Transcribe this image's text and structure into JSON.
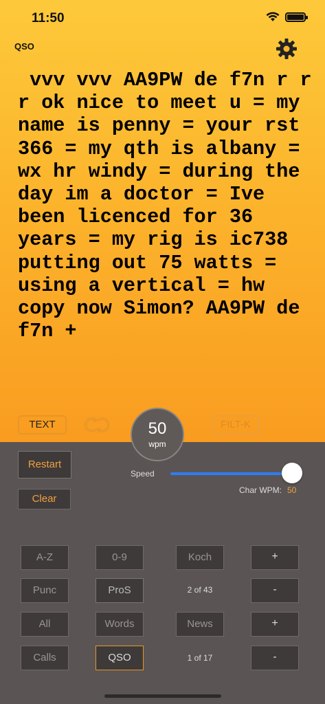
{
  "status": {
    "time": "11:50"
  },
  "header": {
    "mode": "QSO"
  },
  "message": " vvv vvv AA9PW de f7n r r r ok nice to meet u = my name is penny = your rst 366 = my qth is albany = wx hr windy = during the day im a doctor = Ive been licenced for 36 years = my rig is ic738 putting out 75 watts = using a vertical = hw copy now Simon? AA9PW de f7n +",
  "controls": {
    "text_button": "TEXT",
    "filter_button": "FILT-K",
    "wpm_value": "50",
    "wpm_unit": "wpm"
  },
  "panel": {
    "restart": "Restart",
    "clear": "Clear",
    "speed_label": "Speed",
    "speed_fraction": 1.0,
    "char_wpm_label": "Char WPM:",
    "char_wpm_value": "50"
  },
  "grid": {
    "az": "A-Z",
    "digits": "0-9",
    "koch": "Koch",
    "plus": "+",
    "minus": "-",
    "punc": "Punc",
    "pros": "ProS",
    "counter1": "2 of 43",
    "all": "All",
    "words": "Words",
    "news": "News",
    "calls": "Calls",
    "qso": "QSO",
    "counter2": "1 of 17"
  },
  "colors": {
    "accent": "#e8952a",
    "slider": "#2f7cf6",
    "panel": "#5a5554"
  }
}
